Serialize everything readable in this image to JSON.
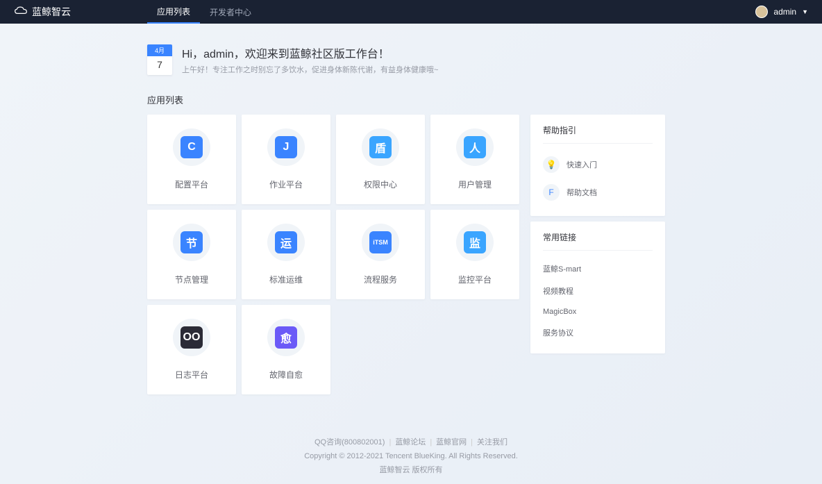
{
  "header": {
    "logo_text": "蓝鲸智云",
    "nav": [
      {
        "label": "应用列表",
        "active": true
      },
      {
        "label": "开发者中心",
        "active": false
      }
    ],
    "username": "admin"
  },
  "welcome": {
    "month": "4月",
    "day": "7",
    "title": "Hi，admin，欢迎来到蓝鲸社区版工作台！",
    "subtitle": "上午好！专注工作之时别忘了多饮水，促进身体新陈代谢，有益身体健康哦~"
  },
  "apps_title": "应用列表",
  "apps": [
    {
      "name": "配置平台",
      "color": "#3a84ff",
      "glyph": "C"
    },
    {
      "name": "作业平台",
      "color": "#3a84ff",
      "glyph": "J"
    },
    {
      "name": "权限中心",
      "color": "#3aa5ff",
      "glyph": "盾"
    },
    {
      "name": "用户管理",
      "color": "#3aa5ff",
      "glyph": "人"
    },
    {
      "name": "节点管理",
      "color": "#3a84ff",
      "glyph": "节"
    },
    {
      "name": "标准运维",
      "color": "#3a84ff",
      "glyph": "运"
    },
    {
      "name": "流程服务",
      "color": "#3a84ff",
      "glyph": "iTSM"
    },
    {
      "name": "监控平台",
      "color": "#3aa5ff",
      "glyph": "监"
    },
    {
      "name": "日志平台",
      "color": "#2b2b36",
      "glyph": "OO"
    },
    {
      "name": "故障自愈",
      "color": "#6b5af7",
      "glyph": "愈"
    }
  ],
  "help": {
    "title": "帮助指引",
    "items": [
      {
        "label": "快速入门",
        "icon": "💡",
        "color": "#ffb848"
      },
      {
        "label": "帮助文档",
        "icon": "F",
        "color": "#3a84ff"
      }
    ]
  },
  "links": {
    "title": "常用链接",
    "items": [
      {
        "label": "蓝鲸S-mart"
      },
      {
        "label": "视频教程"
      },
      {
        "label": "MagicBox"
      },
      {
        "label": "服务协议"
      }
    ]
  },
  "footer": {
    "links": [
      "QQ咨询(800802001)",
      "蓝鲸论坛",
      "蓝鲸官网",
      "关注我们"
    ],
    "copyright": "Copyright © 2012-2021 Tencent BlueKing. All Rights Reserved.",
    "company": "蓝鲸智云 版权所有"
  }
}
